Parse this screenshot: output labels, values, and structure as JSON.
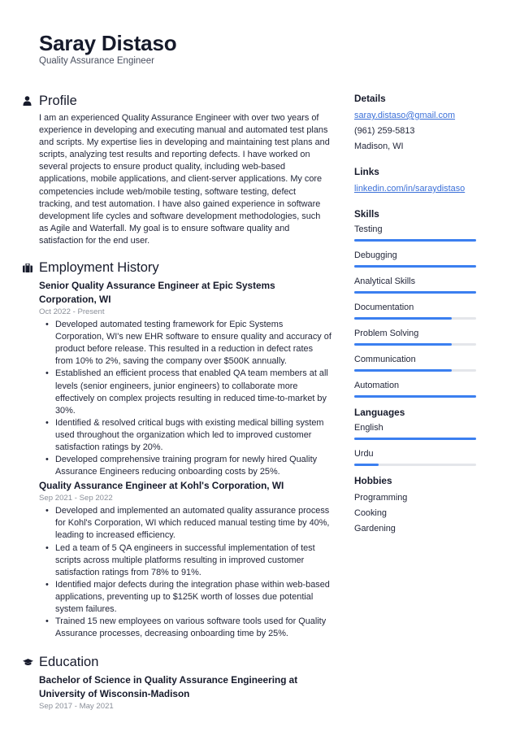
{
  "header": {
    "name": "Saray Distaso",
    "title": "Quality Assurance Engineer"
  },
  "profile": {
    "heading": "Profile",
    "icon": "person-icon",
    "text": "I am an experienced Quality Assurance Engineer with over two years of experience in developing and executing manual and automated test plans and scripts. My expertise lies in developing and maintaining test plans and scripts, analyzing test results and reporting defects. I have worked on several projects to ensure product quality, including web-based applications, mobile applications, and client-server applications. My core competencies include web/mobile testing, software testing, defect tracking, and test automation. I have also gained experience in software development life cycles and software development methodologies, such as Agile and Waterfall. My goal is to ensure software quality and satisfaction for the end user."
  },
  "employment": {
    "heading": "Employment History",
    "icon": "briefcase-icon",
    "jobs": [
      {
        "title": "Senior Quality Assurance Engineer at Epic Systems Corporation, WI",
        "dates": "Oct 2022 - Present",
        "bullets": [
          "Developed automated testing framework for Epic Systems Corporation, WI's new EHR software to ensure quality and accuracy of product before release. This resulted in a reduction in defect rates from 10% to 2%, saving the company over $500K annually.",
          "Established an efficient process that enabled QA team members at all levels (senior engineers, junior engineers) to collaborate more effectively on complex projects resulting in reduced time-to-market by 30%.",
          "Identified & resolved critical bugs with existing medical billing system used throughout the organization which led to improved customer satisfaction ratings by 20%.",
          "Developed comprehensive training program for newly hired Quality Assurance Engineers reducing onboarding costs by 25%."
        ]
      },
      {
        "title": "Quality Assurance Engineer at Kohl's Corporation, WI",
        "dates": "Sep 2021 - Sep 2022",
        "bullets": [
          "Developed and implemented an automated quality assurance process for Kohl's Corporation, WI which reduced manual testing time by 40%, leading to increased efficiency.",
          "Led a team of 5 QA engineers in successful implementation of test scripts across multiple platforms resulting in improved customer satisfaction ratings from 78% to 91%.",
          "Identified major defects during the integration phase within web-based applications, preventing up to $125K worth of losses due potential system failures.",
          "Trained 15 new employees on various software tools used for Quality Assurance processes, decreasing onboarding time by 25%."
        ]
      }
    ]
  },
  "education": {
    "heading": "Education",
    "icon": "graduation-cap-icon",
    "items": [
      {
        "title": "Bachelor of Science in Quality Assurance Engineering at University of Wisconsin-Madison",
        "dates": "Sep 2017 - May 2021"
      }
    ]
  },
  "details": {
    "heading": "Details",
    "email": "saray.distaso@gmail.com",
    "phone": "(961) 259-5813",
    "location": "Madison, WI"
  },
  "links": {
    "heading": "Links",
    "items": [
      "linkedin.com/in/saraydistaso"
    ]
  },
  "skills": {
    "heading": "Skills",
    "items": [
      {
        "label": "Testing",
        "level": 1.0
      },
      {
        "label": "Debugging",
        "level": 1.0
      },
      {
        "label": "Analytical Skills",
        "level": 1.0
      },
      {
        "label": "Documentation",
        "level": 0.8
      },
      {
        "label": "Problem Solving",
        "level": 0.8
      },
      {
        "label": "Communication",
        "level": 0.8
      },
      {
        "label": "Automation",
        "level": 1.0
      }
    ]
  },
  "languages": {
    "heading": "Languages",
    "items": [
      {
        "label": "English",
        "level": 1.0
      },
      {
        "label": "Urdu",
        "level": 0.2
      }
    ]
  },
  "hobbies": {
    "heading": "Hobbies",
    "items": [
      "Programming",
      "Cooking",
      "Gardening"
    ]
  },
  "colors": {
    "accent": "#3b7ff0",
    "link": "#3a6fd8",
    "bar_track": "#e4e6ea"
  }
}
